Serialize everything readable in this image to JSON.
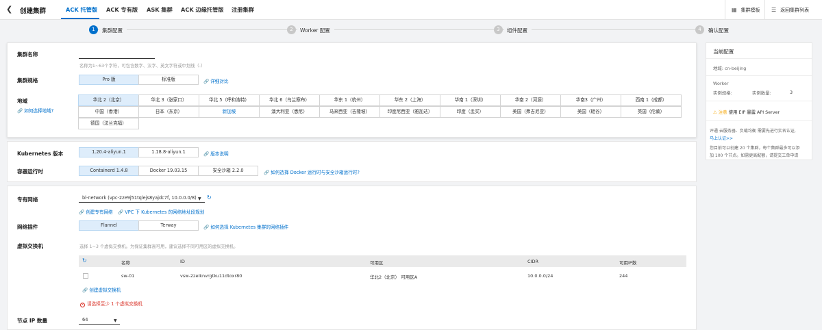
{
  "header": {
    "title": "创建集群",
    "tabs": [
      "ACK 托管版",
      "ACK 专有版",
      "ASK 集群",
      "ACK 边缘托管版",
      "注册集群"
    ],
    "template_btn": "集群模板",
    "back_list_btn": "返回集群列表"
  },
  "steps": [
    "集群配置",
    "Worker 配置",
    "组件配置",
    "确认配置"
  ],
  "cluster": {
    "name_label": "集群名称",
    "name_value": "",
    "name_hint": "名称为1~63个字符，可包含数字、汉字、英文字符或中划线（-）",
    "spec_label": "集群规格",
    "spec_options": [
      "Pro 版",
      "标准版"
    ],
    "spec_link": "详细对比",
    "region_label": "地域",
    "region_link": "如何选择地域?",
    "regions": [
      "华北 2（北京）",
      "华北 3（张家口）",
      "华北 5（呼和浩特）",
      "华北 6（乌兰察布）",
      "华东 1（杭州）",
      "华东 2（上海）",
      "华南 1（深圳）",
      "华南 2（河源）",
      "华南3（广州）",
      "西南 1（成都）",
      "中国（香港）",
      "日本（东京）",
      "新加坡",
      "澳大利亚（悉尼）",
      "马来西亚（吉隆坡）",
      "印度尼西亚（雅加达）",
      "印度（孟买）",
      "美国（弗吉尼亚）",
      "美国（硅谷）",
      "英国（伦敦）",
      "德国（法兰克福）"
    ]
  },
  "k8s": {
    "version_label": "Kubernetes 版本",
    "versions": [
      "1.20.4-aliyun.1",
      "1.18.8-aliyun.1"
    ],
    "version_link": "版本说明",
    "runtime_label": "容器运行时",
    "runtimes": [
      "Containerd 1.4.8",
      "Docker 19.03.15",
      "安全沙箱 2.2.0"
    ],
    "runtime_link": "如何选择 Docker 运行时与安全沙箱运行时?"
  },
  "network": {
    "vpc_label": "专有网络",
    "vpc_value": "bl-network (vpc-2ze9j51tqlejs8yajdc7f, 10.0.0.0/8)",
    "vpc_link1": "创建专有网络",
    "vpc_link2": "VPC 下 Kubernetes 的网络地址段规划",
    "plugin_label": "网络插件",
    "plugins": [
      "Flannel",
      "Terway"
    ],
    "plugin_link": "如何选择 Kubernetes 集群的网络插件",
    "vswitch_label": "虚拟交换机",
    "vswitch_hint": "选择 1~3 个虚拟交换机。为保证集群高可用，建议选择不同可用区的虚拟交换机。",
    "table_headers": [
      "名称",
      "ID",
      "可用区",
      "CIDR",
      "可用IP数"
    ],
    "rows": [
      {
        "name": "sw-01",
        "id": "vsw-2zeiknvrgtku11dtoxr80",
        "zone": "华北2（北京） 可用区A",
        "cidr": "10.0.0.0/24",
        "ips": "244"
      }
    ],
    "create_vswitch": "创建虚拟交换机",
    "error": "请选择至少 1 个虚拟交换机",
    "node_ip_label": "节点 IP 数量",
    "node_ip_value": "64"
  },
  "side": {
    "title": "当前配置",
    "region": "地域:  cn-beijing",
    "worker": "Worker",
    "spec": "实例规格:",
    "count": "实例数量:",
    "count_value": "3",
    "notice_prefix": "注意",
    "notice": " 使用 EIP 暴露 API Server",
    "text1": "评通 云服务器、负载均衡 需要先进行实名认证,",
    "link": "马上认证>>",
    "text2": "您目前可以创建 20 个集群，每个集群最多可以添",
    "text3": "加 100 个节点。如需更高配额，请提交工单申请"
  }
}
